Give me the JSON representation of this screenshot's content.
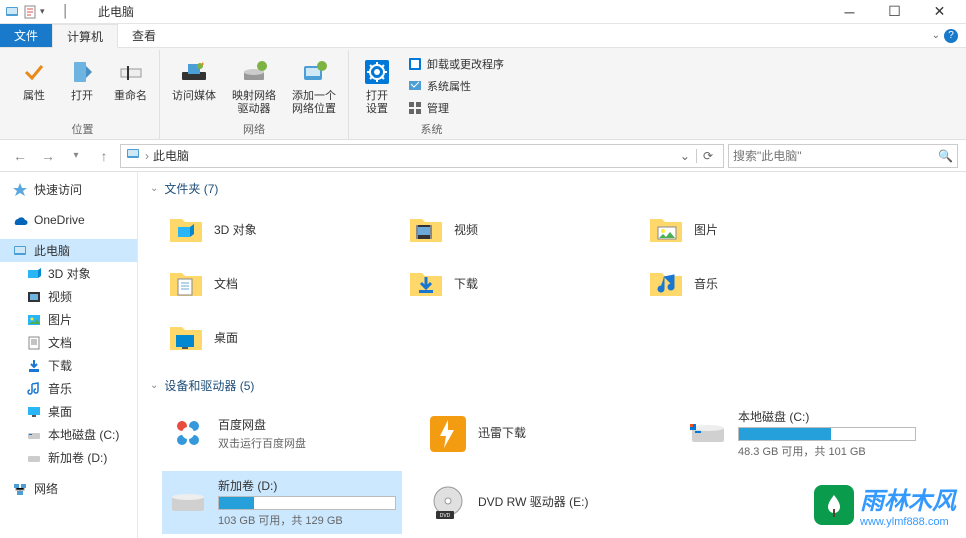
{
  "window": {
    "title": "此电脑"
  },
  "tabs": {
    "file": "文件",
    "computer": "计算机",
    "view": "查看"
  },
  "ribbon": {
    "location": {
      "label": "位置",
      "properties": "属性",
      "open": "打开",
      "rename": "重命名"
    },
    "network": {
      "label": "网络",
      "media": "访问媒体",
      "mapdrive": "映射网络\n驱动器",
      "addloc": "添加一个\n网络位置"
    },
    "system": {
      "label": "系统",
      "opensettings": "打开\n设置",
      "uninstall": "卸载或更改程序",
      "sysprops": "系统属性",
      "manage": "管理"
    }
  },
  "address": {
    "location": "此电脑",
    "searchPlaceholder": "搜索\"此电脑\""
  },
  "sidebar": {
    "quickaccess": "快速访问",
    "onedrive": "OneDrive",
    "thispc": "此电脑",
    "items": [
      {
        "label": "3D 对象"
      },
      {
        "label": "视频"
      },
      {
        "label": "图片"
      },
      {
        "label": "文档"
      },
      {
        "label": "下载"
      },
      {
        "label": "音乐"
      },
      {
        "label": "桌面"
      },
      {
        "label": "本地磁盘 (C:)"
      },
      {
        "label": "新加卷 (D:)"
      }
    ],
    "network": "网络"
  },
  "content": {
    "foldersHeader": "文件夹 (7)",
    "folders": [
      {
        "label": "3D 对象"
      },
      {
        "label": "视频"
      },
      {
        "label": "图片"
      },
      {
        "label": "文档"
      },
      {
        "label": "下载"
      },
      {
        "label": "音乐"
      },
      {
        "label": "桌面"
      }
    ],
    "drivesHeader": "设备和驱动器 (5)",
    "drives": [
      {
        "name": "百度网盘",
        "sub": "双击运行百度网盘",
        "type": "app"
      },
      {
        "name": "迅雷下载",
        "type": "app-thunder"
      },
      {
        "name": "本地磁盘 (C:)",
        "free": "48.3 GB 可用，共 101 GB",
        "pct": 52,
        "type": "disk"
      },
      {
        "name": "新加卷 (D:)",
        "free": "103 GB 可用，共 129 GB",
        "pct": 20,
        "type": "disk",
        "selected": true
      },
      {
        "name": "DVD RW 驱动器 (E:)",
        "type": "dvd"
      }
    ]
  },
  "watermark": {
    "text": "雨林木风",
    "url": "www.ylmf888.com"
  }
}
